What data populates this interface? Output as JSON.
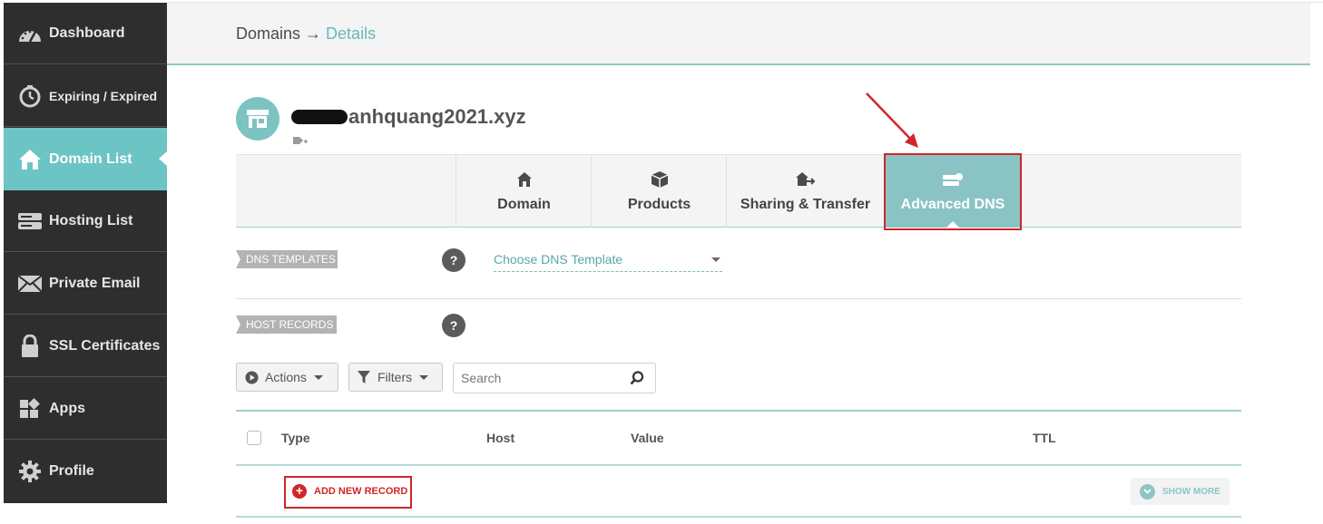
{
  "sidebar": {
    "items": [
      {
        "label": "Dashboard",
        "icon": "dashboard-gauge-icon"
      },
      {
        "label": "Expiring / Expired",
        "icon": "stopwatch-icon"
      },
      {
        "label": "Domain List",
        "icon": "home-icon",
        "active": true
      },
      {
        "label": "Hosting List",
        "icon": "server-icon"
      },
      {
        "label": "Private Email",
        "icon": "envelope-icon"
      },
      {
        "label": "SSL Certificates",
        "icon": "lock-icon"
      },
      {
        "label": "Apps",
        "icon": "apps-grid-icon"
      },
      {
        "label": "Profile",
        "icon": "gear-icon"
      }
    ]
  },
  "header": {
    "crumb_parent": "Domains",
    "crumb_sep": " → ",
    "crumb_current": "Details"
  },
  "domain": {
    "name_suffix": "anhquang2021.xyz"
  },
  "tabs": [
    {
      "label": "Domain",
      "icon": "home-icon"
    },
    {
      "label": "Products",
      "icon": "box-icon"
    },
    {
      "label": "Sharing & Transfer",
      "icon": "house-arrow-icon"
    },
    {
      "label": "Advanced DNS",
      "icon": "dns-server-icon",
      "active": true
    }
  ],
  "dns_templates": {
    "label": "DNS TEMPLATES",
    "help": "?",
    "select_value": "Choose DNS Template"
  },
  "host_records": {
    "label": "HOST RECORDS",
    "help": "?"
  },
  "controls": {
    "actions_label": "Actions",
    "filters_label": "Filters",
    "search_placeholder": "Search"
  },
  "table": {
    "columns": [
      "Type",
      "Host",
      "Value",
      "TTL"
    ]
  },
  "add_record_label": "ADD NEW RECORD",
  "show_more_label": "SHOW MORE",
  "colors": {
    "sidebar_bg": "#2e2e2e",
    "accent_teal": "#6cc4c4",
    "tab_active": "#8ac3c3",
    "highlight_red": "#d0262a"
  }
}
